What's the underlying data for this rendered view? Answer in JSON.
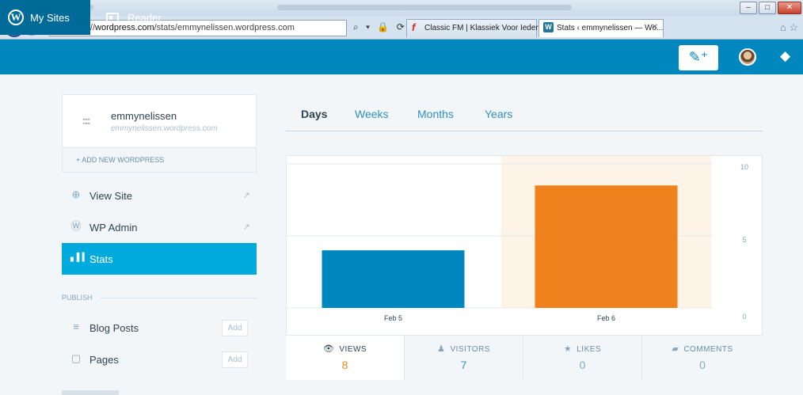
{
  "browser": {
    "url_prefix": "https://",
    "url_host": "wordpress.com",
    "url_path": "/stats/emmynelissen.wordpress.com",
    "address_controls": "⌕ ▾ 🔒 ⟳",
    "tabs": [
      {
        "label": "Classic FM | Klassiek Voor Ieder...",
        "active": false
      },
      {
        "label": "Stats ‹ emmynelissen — Wo...",
        "active": true
      }
    ]
  },
  "masterbar": {
    "my_sites": "My Sites",
    "reader": "Reader"
  },
  "sidebar": {
    "site_name": "emmynelissen",
    "site_url": "emmynelissen.wordpress.com",
    "add_new": "+ ADD NEW WORDPRESS",
    "items": [
      {
        "label": "View Site",
        "icon": "globe-icon"
      },
      {
        "label": "WP Admin",
        "icon": "wordpress-icon"
      },
      {
        "label": "Stats",
        "icon": "bar-chart-icon"
      }
    ],
    "publish_header": "PUBLISH",
    "publish_items": [
      {
        "label": "Blog Posts",
        "add": "Add"
      },
      {
        "label": "Pages",
        "add": "Add"
      }
    ]
  },
  "period_tabs": {
    "days": "Days",
    "weeks": "Weeks",
    "months": "Months",
    "years": "Years"
  },
  "chart_data": {
    "type": "bar",
    "categories": [
      "Feb 5",
      "Feb 6"
    ],
    "values": [
      4,
      8.5
    ],
    "highlight_category": "Feb 6",
    "ylim": [
      0,
      10
    ],
    "yticks": [
      "0",
      "5",
      "10"
    ],
    "colors": {
      "default": "#0087be",
      "highlight": "#f0821e",
      "highlight_bg": "#fdf3e7"
    }
  },
  "stat_tabs": [
    {
      "icon": "eye-icon",
      "label": "VIEWS",
      "value": "8"
    },
    {
      "icon": "person-icon",
      "label": "VISITORS",
      "value": "7"
    },
    {
      "icon": "star-icon",
      "label": "LIKES",
      "value": "0"
    },
    {
      "icon": "comment-icon",
      "label": "COMMENTS",
      "value": "0"
    }
  ]
}
